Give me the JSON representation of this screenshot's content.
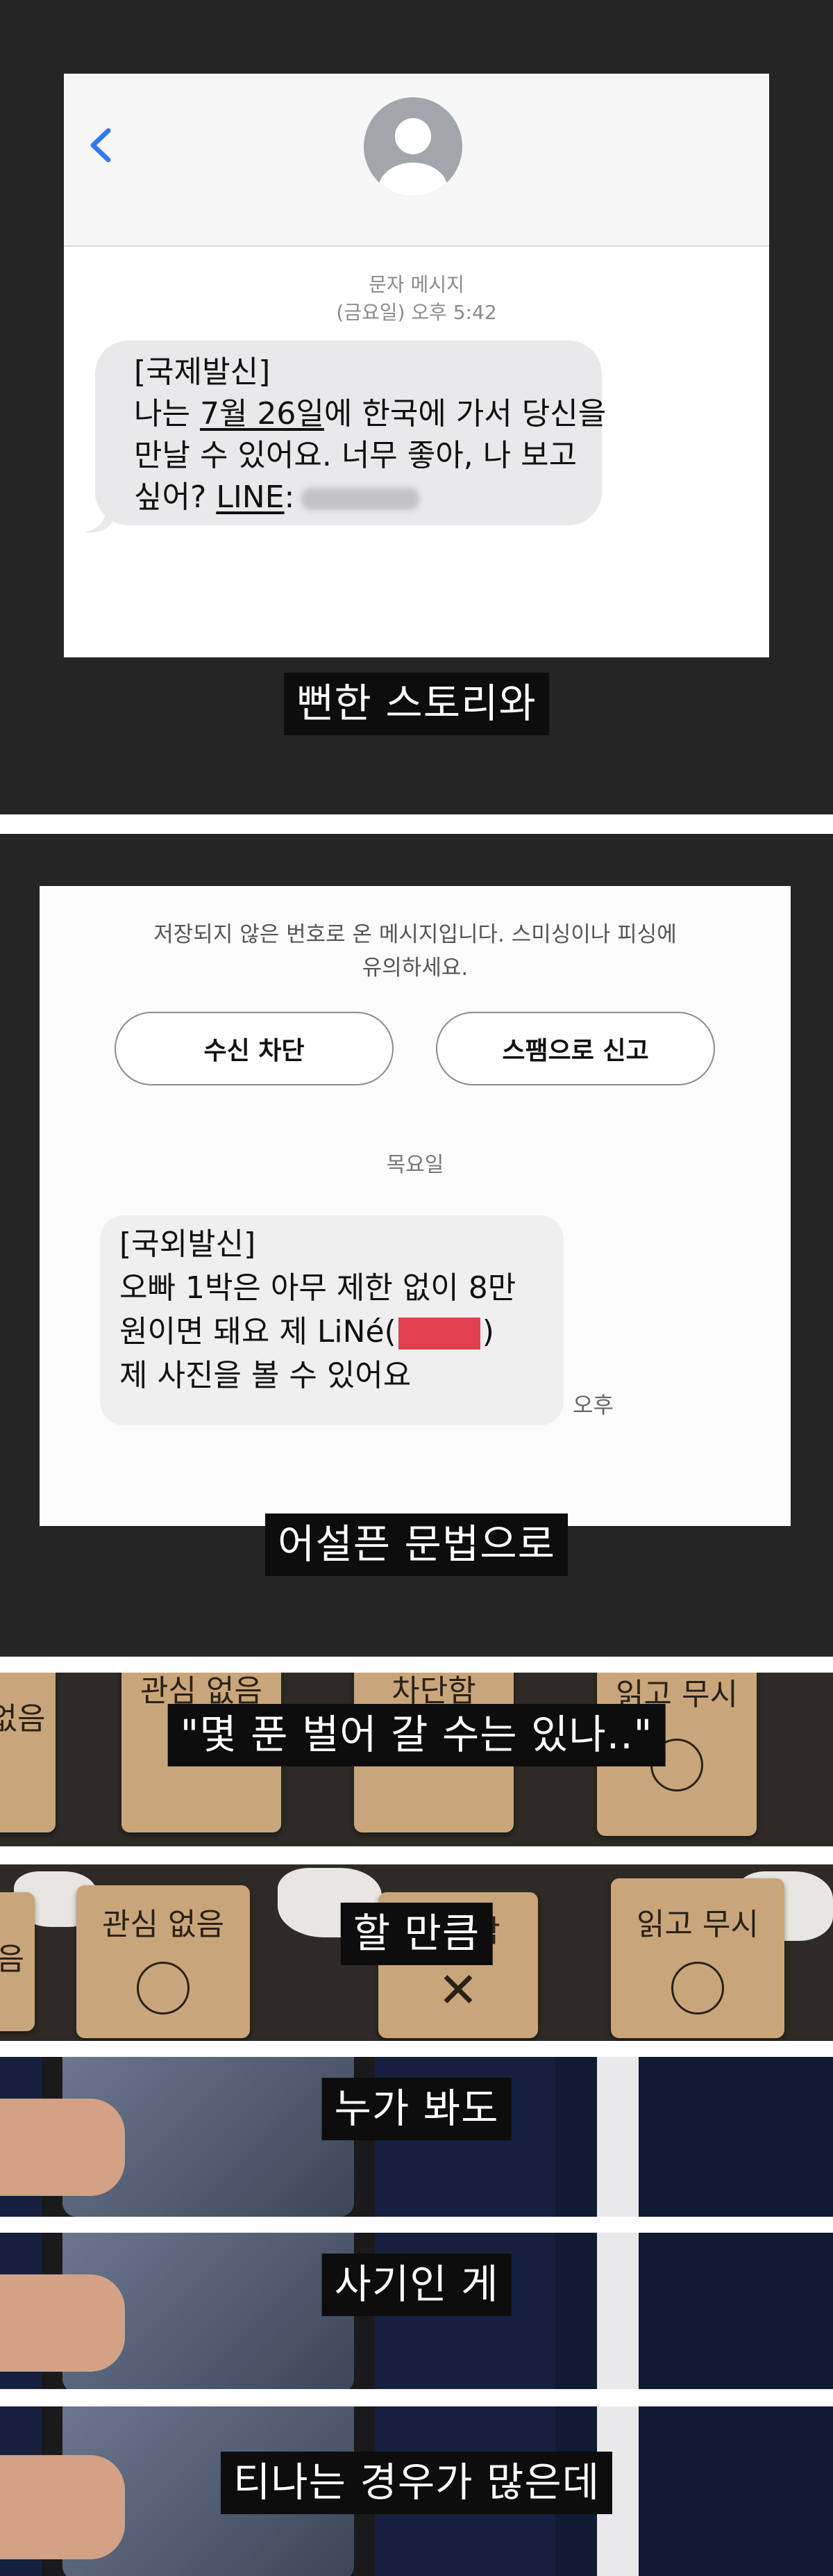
{
  "panel1": {
    "header": {
      "meta_type": "문자 메시지",
      "meta_time": "(금요일) 오후 5:42"
    },
    "message": {
      "line1": "[국제발신]",
      "line2_a": "나는 ",
      "line2_u": "7월 26일",
      "line2_b": "에 한국에 가서 당신을",
      "line3": "만날 수 있어요. 너무 좋아, 나 보고",
      "line4_a": "싶어? ",
      "line4_u": "LINE",
      "line4_b": ":"
    },
    "caption": "뻔한 스토리와"
  },
  "panel2": {
    "warning_line1": "저장되지 않은 번호로 온 메시지입니다. 스미싱이나 피싱에",
    "warning_line2": "유의하세요.",
    "block_button": "수신 차단",
    "report_button": "스팸으로 신고",
    "day": "목요일",
    "message": {
      "line1": "[국외발신]",
      "line2": "오빠 1박은 아무 제한 없이 8만",
      "line3_a": "원이면 돼요  제 LiNé(",
      "line3_b": ")",
      "line4": "제 사진을 볼 수 있어요"
    },
    "time": "오후",
    "caption": "어설픈 문법으로"
  },
  "strips": [
    {
      "caption": "\"몇 푼 벌어 갈 수는 있나..\"",
      "cards": [
        "없음",
        "관심 없음",
        "차단함",
        "읽고 무시"
      ]
    },
    {
      "caption": "할 만큼",
      "cards": [
        "음",
        "관심 없음",
        "차단함",
        "읽고 무시"
      ]
    },
    {
      "caption": "누가 봐도"
    },
    {
      "caption": "사기인 게"
    },
    {
      "caption": "티나는 경우가 많은데"
    }
  ],
  "colors": {
    "ios_blue": "#3478f6",
    "bubble_gray": "#e9e9eb",
    "caption_bg": "#0d0d0d",
    "redaction": "#e0404f"
  }
}
